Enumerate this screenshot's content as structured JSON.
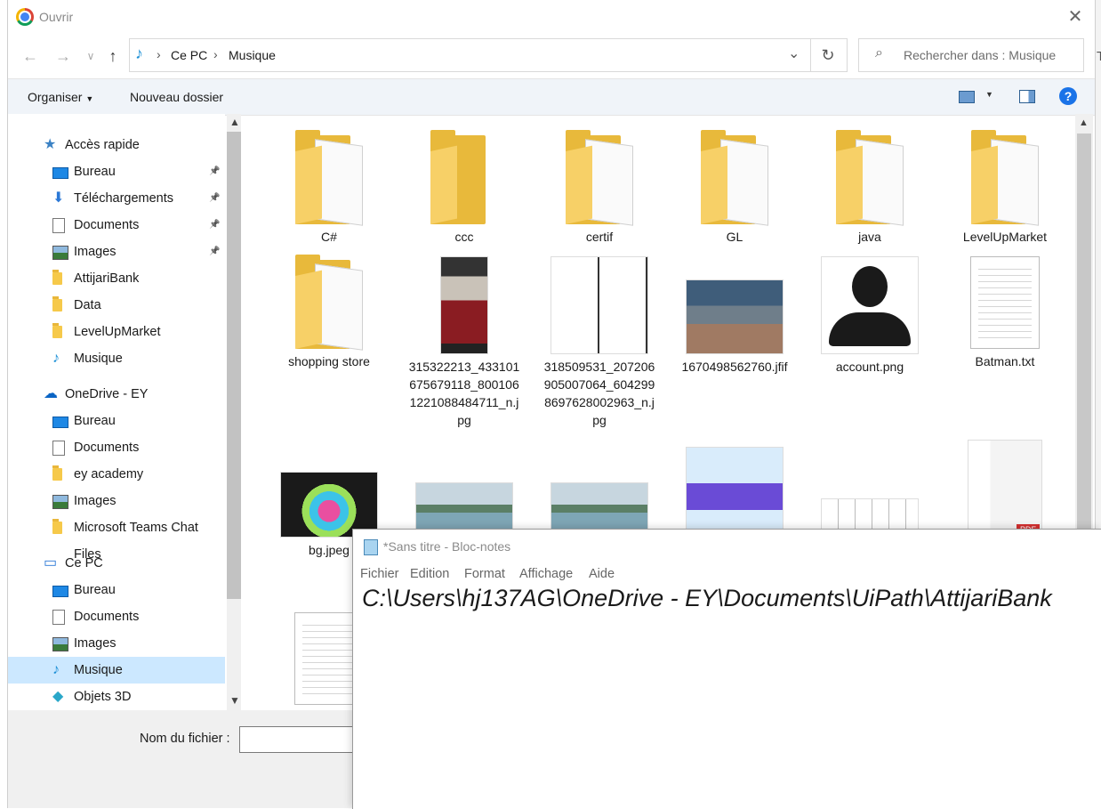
{
  "window": {
    "title": "Ouvrir",
    "close_icon": "close-icon"
  },
  "nav": {
    "back": "←",
    "forward": "→",
    "recent": "∨",
    "up": "↑",
    "breadcrumb": [
      "Ce PC",
      "Musique"
    ],
    "search_placeholder": "Rechercher dans : Musique"
  },
  "toolbar": {
    "organize": "Organiser",
    "new_folder": "Nouveau dossier"
  },
  "sidebar": {
    "items": [
      {
        "label": "Accès rapide",
        "icon": "star-icon",
        "pinned": false
      },
      {
        "label": "Bureau",
        "icon": "desktop-icon",
        "pinned": true
      },
      {
        "label": "Téléchargements",
        "icon": "download-icon",
        "pinned": true
      },
      {
        "label": "Documents",
        "icon": "document-icon",
        "pinned": true
      },
      {
        "label": "Images",
        "icon": "image-icon",
        "pinned": true
      },
      {
        "label": "AttijariBank",
        "icon": "folder-icon",
        "pinned": false
      },
      {
        "label": "Data",
        "icon": "folder-icon",
        "pinned": false
      },
      {
        "label": "LevelUpMarket",
        "icon": "folder-icon",
        "pinned": false
      },
      {
        "label": "Musique",
        "icon": "music-icon",
        "pinned": false
      },
      {
        "label": "OneDrive - EY",
        "icon": "cloud-icon",
        "pinned": false
      },
      {
        "label": "Bureau",
        "icon": "desktop-icon",
        "pinned": false
      },
      {
        "label": "Documents",
        "icon": "document-icon",
        "pinned": false
      },
      {
        "label": "ey academy",
        "icon": "folder-icon",
        "pinned": false
      },
      {
        "label": "Images",
        "icon": "image-icon",
        "pinned": false
      },
      {
        "label": "Microsoft Teams Chat Files",
        "icon": "folder-icon",
        "pinned": false
      },
      {
        "label": "Ce PC",
        "icon": "computer-icon",
        "pinned": false
      },
      {
        "label": "Bureau",
        "icon": "desktop-icon",
        "pinned": false
      },
      {
        "label": "Documents",
        "icon": "document-icon",
        "pinned": false
      },
      {
        "label": "Images",
        "icon": "image-icon",
        "pinned": false
      },
      {
        "label": "Musique",
        "icon": "music-icon",
        "pinned": false,
        "selected": true
      },
      {
        "label": "Objets 3D",
        "icon": "cube-icon",
        "pinned": false
      }
    ]
  },
  "files": [
    {
      "name": "C#",
      "type": "folder"
    },
    {
      "name": "ccc",
      "type": "folder-empty"
    },
    {
      "name": "certif",
      "type": "folder"
    },
    {
      "name": "GL",
      "type": "folder"
    },
    {
      "name": "java",
      "type": "folder"
    },
    {
      "name": "LevelUpMarket",
      "type": "folder"
    },
    {
      "name": "shopping store",
      "type": "folder"
    },
    {
      "name": "315322213_433101675679118_8001061221088484711_n.jpg",
      "type": "photo-portrait"
    },
    {
      "name": "318509531_207206905007064_6042998697628002963_n.jpg",
      "type": "photo-comic"
    },
    {
      "name": "1670498562760.jfif",
      "type": "photo-group"
    },
    {
      "name": "account.png",
      "type": "avatar"
    },
    {
      "name": "Batman.txt",
      "type": "text"
    },
    {
      "name": "bg.jpeg",
      "type": "photo-hands"
    },
    {
      "name": "",
      "type": "photo-lake"
    },
    {
      "name": "",
      "type": "photo-lake"
    },
    {
      "name": "",
      "type": "photo-bundle"
    },
    {
      "name": "",
      "type": "photo-diagram"
    },
    {
      "name": "",
      "type": "photo-cv"
    },
    {
      "name": "",
      "type": "text"
    }
  ],
  "footer": {
    "filename_label": "Nom du fichier :",
    "filename_value": ""
  },
  "notepad": {
    "title": "*Sans titre - Bloc-notes",
    "menu": [
      "Fichier",
      "Edition",
      "Format",
      "Affichage",
      "Aide"
    ],
    "text": "C:\\Users\\hj137AG\\OneDrive - EY\\Documents\\UiPath\\AttijariBank"
  },
  "colors": {
    "selection": "#cce8ff",
    "folder": "#e8b93b",
    "toolbar": "#f0f4f9",
    "help": "#1a73e8"
  }
}
